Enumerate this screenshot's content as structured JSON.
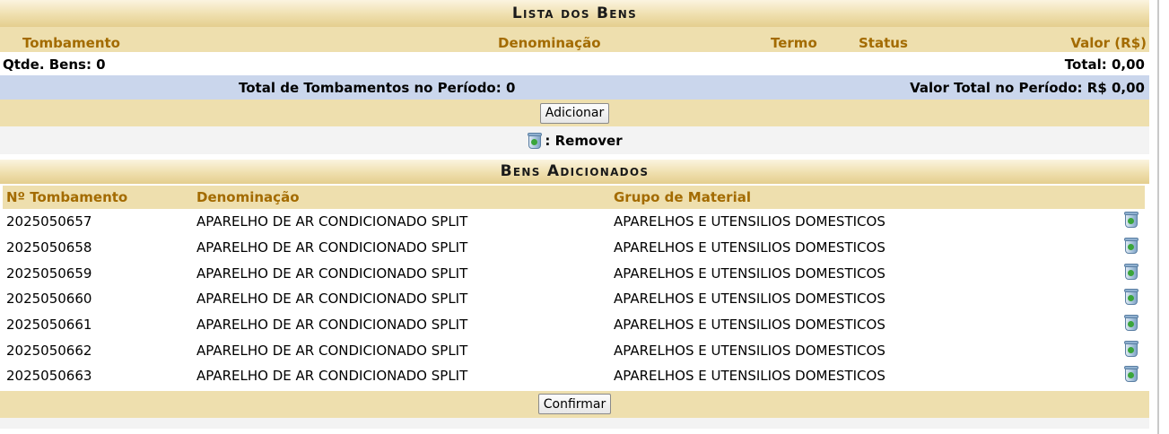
{
  "lista": {
    "caption": "Lista dos Bens",
    "headers": {
      "tombamento": "Tombamento",
      "denominacao": "Denominação",
      "termo": "Termo",
      "status": "Status",
      "valor": "Valor (R$)"
    },
    "qtde": "Qtde. Bens: 0",
    "total": "Total: 0,00",
    "total_tombamentos": "Total de Tombamentos no Período: 0",
    "valor_total": "Valor Total no Período: R$ 0,00",
    "add_button": "Adicionar"
  },
  "legend": {
    "remove_label": ": Remover",
    "icon": "trash-icon"
  },
  "adicionados": {
    "caption": "Bens Adicionados",
    "headers": {
      "numero": "Nº Tombamento",
      "denominacao": "Denominação",
      "grupo": "Grupo de Material"
    },
    "rows": [
      {
        "numero": "2025050657",
        "denominacao": "APARELHO DE AR CONDICIONADO SPLIT",
        "grupo": "APARELHOS E UTENSILIOS DOMESTICOS"
      },
      {
        "numero": "2025050658",
        "denominacao": "APARELHO DE AR CONDICIONADO SPLIT",
        "grupo": "APARELHOS E UTENSILIOS DOMESTICOS"
      },
      {
        "numero": "2025050659",
        "denominacao": "APARELHO DE AR CONDICIONADO SPLIT",
        "grupo": "APARELHOS E UTENSILIOS DOMESTICOS"
      },
      {
        "numero": "2025050660",
        "denominacao": "APARELHO DE AR CONDICIONADO SPLIT",
        "grupo": "APARELHOS E UTENSILIOS DOMESTICOS"
      },
      {
        "numero": "2025050661",
        "denominacao": "APARELHO DE AR CONDICIONADO SPLIT",
        "grupo": "APARELHOS E UTENSILIOS DOMESTICOS"
      },
      {
        "numero": "2025050662",
        "denominacao": "APARELHO DE AR CONDICIONADO SPLIT",
        "grupo": "APARELHOS E UTENSILIOS DOMESTICOS"
      },
      {
        "numero": "2025050663",
        "denominacao": "APARELHO DE AR CONDICIONADO SPLIT",
        "grupo": "APARELHOS E UTENSILIOS DOMESTICOS"
      }
    ],
    "confirm_button": "Confirmar"
  },
  "colors": {
    "header_gold": "#eedfae",
    "header_text": "#a36b00",
    "blue_row": "#cad6ec"
  }
}
